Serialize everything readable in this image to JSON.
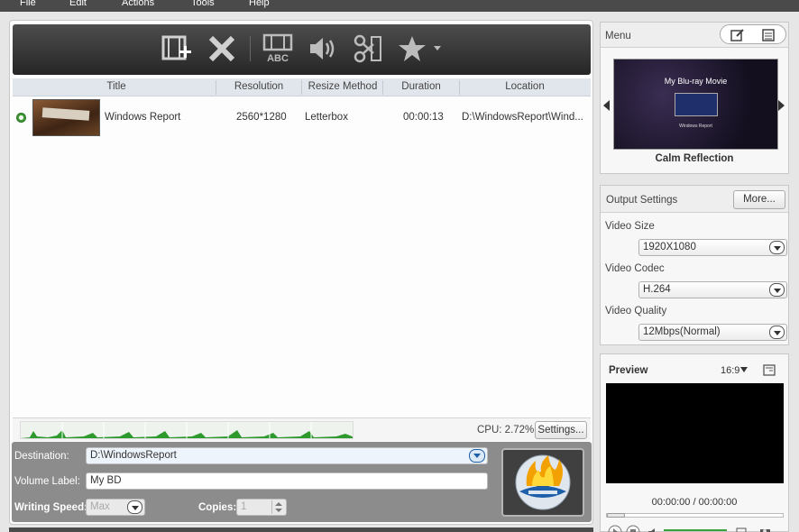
{
  "menu": {
    "items": [
      "File",
      "Edit",
      "Actions",
      "Tools",
      "Help"
    ]
  },
  "toolbar": {
    "icons": [
      "add-video-icon",
      "delete-icon",
      "subtitle-abc-icon",
      "audio-icon",
      "edit-trim-icon",
      "effects-star-icon"
    ]
  },
  "table": {
    "columns": [
      "Title",
      "Resolution",
      "Resize Method",
      "Duration",
      "Location"
    ],
    "rows": [
      {
        "title": "Windows Report",
        "resolution": "2560*1280",
        "resize": "Letterbox",
        "duration": "00:00:13",
        "location": "D:\\WindowsReport\\Wind..."
      }
    ]
  },
  "status": {
    "cpu": "CPU: 2.72%",
    "settings": "Settings..."
  },
  "output": {
    "destination_label": "Destination:",
    "destination": "D:\\WindowsReport",
    "volume_label": "Volume Label:",
    "volume": "My BD",
    "speed_label": "Writing Speed:",
    "speed": "Max",
    "copies_label": "Copies:",
    "copies": "1"
  },
  "menu_panel": {
    "title": "Menu",
    "preview_title": "My Blu-ray Movie",
    "preview_sub": "Windows Report",
    "theme": "Calm Reflection"
  },
  "output_settings": {
    "title": "Output Settings",
    "more": "More...",
    "video_size_label": "Video Size",
    "video_size": "1920X1080",
    "video_codec_label": "Video Codec",
    "video_codec": "H.264",
    "video_quality_label": "Video Quality",
    "video_quality": "12Mbps(Normal)"
  },
  "preview": {
    "title": "Preview",
    "aspect": "16:9",
    "time": "00:00:00 / 00:00:00"
  },
  "colors": {
    "toolbar": "#2f2f2f",
    "bottom": "#8c8c8c",
    "accent": "#1d5fa8"
  }
}
